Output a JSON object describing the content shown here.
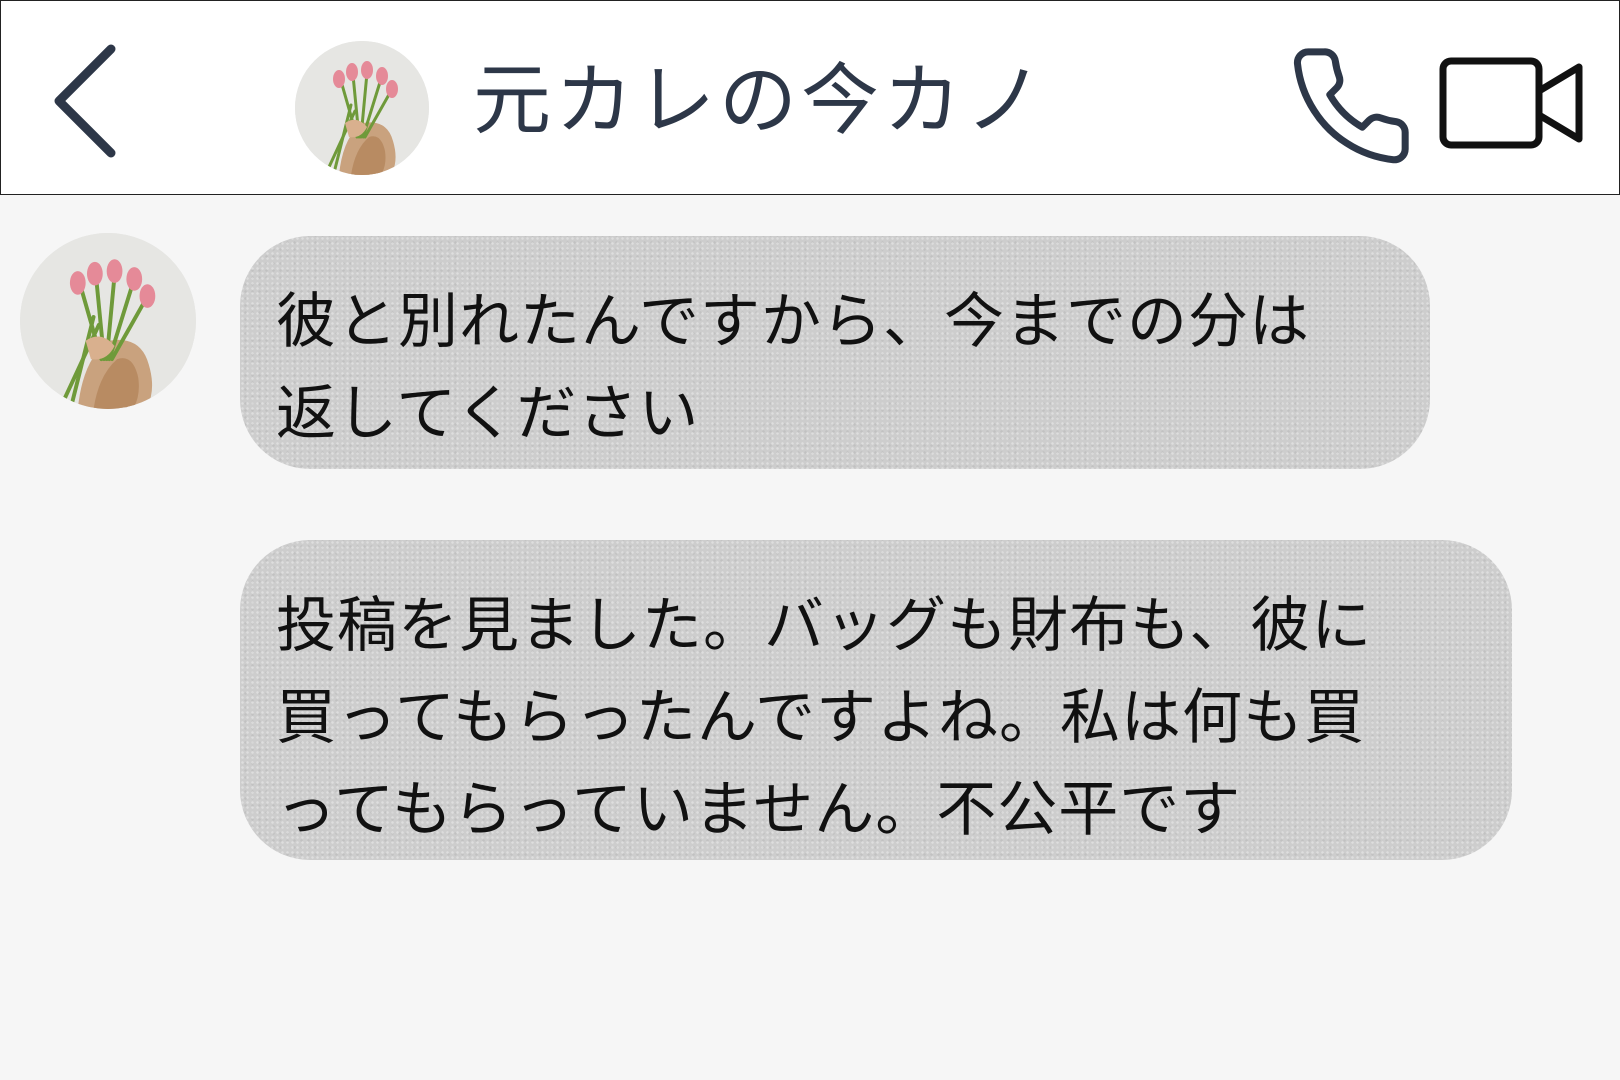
{
  "header": {
    "title": "元カレの今カノ",
    "back_icon": "chevron-left-icon",
    "call_icon": "phone-icon",
    "video_icon": "video-camera-icon",
    "icon_color": "#2d3748"
  },
  "messages": [
    {
      "sender": "incoming",
      "text": "彼と別れたんですから、今までの分は\n返してください"
    },
    {
      "sender": "incoming",
      "text": "投稿を見ました。バッグも財布も、彼に\n買ってもらったんですよね。私は何も買\nってもらっていません。不公平です"
    }
  ],
  "colors": {
    "background": "#f6f6f6",
    "header_background": "#ffffff",
    "bubble": "#cdcdcd",
    "text": "#111111"
  }
}
